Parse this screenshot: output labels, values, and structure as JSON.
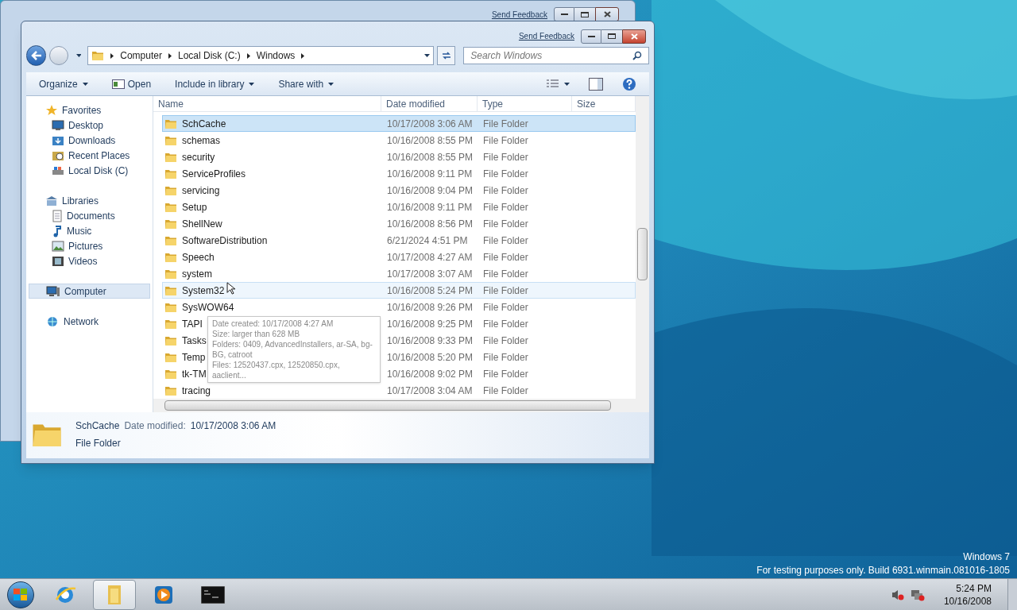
{
  "back_window": {
    "feedback_link": "Send Feedback"
  },
  "window": {
    "feedback_link": "Send Feedback"
  },
  "address_bar": {
    "crumbs": [
      "Computer",
      "Local Disk (C:)",
      "Windows"
    ]
  },
  "search": {
    "placeholder": "Search Windows"
  },
  "toolbar": {
    "items": [
      {
        "label": "Organize",
        "kind": "menu"
      },
      {
        "label": "Open",
        "kind": "icon"
      },
      {
        "label": "Include in library",
        "kind": "menu"
      },
      {
        "label": "Share with",
        "kind": "menu"
      }
    ]
  },
  "nav": {
    "groups": [
      {
        "label": "Favorites",
        "selected": false,
        "children": [
          {
            "label": "Desktop",
            "selected": false
          },
          {
            "label": "Downloads",
            "selected": false
          },
          {
            "label": "Recent Places",
            "selected": false
          },
          {
            "label": "Local Disk (C)",
            "selected": false
          }
        ]
      },
      {
        "label": "Libraries",
        "selected": false,
        "children": [
          {
            "label": "Documents",
            "selected": false
          },
          {
            "label": "Music",
            "selected": false
          },
          {
            "label": "Pictures",
            "selected": false
          },
          {
            "label": "Videos",
            "selected": false
          }
        ]
      },
      {
        "label": "Computer",
        "selected": true
      },
      {
        "label": "Network",
        "selected": false
      }
    ]
  },
  "table": {
    "columns": [
      "Name",
      "Date modified",
      "Type",
      "Size"
    ],
    "rows": [
      {
        "name": "SchCache",
        "date": "10/17/2008 3:06 AM",
        "type": "File Folder",
        "selected": true,
        "hovered": false
      },
      {
        "name": "schemas",
        "date": "10/16/2008 8:55 PM",
        "type": "File Folder",
        "selected": false,
        "hovered": false
      },
      {
        "name": "security",
        "date": "10/16/2008 8:55 PM",
        "type": "File Folder",
        "selected": false,
        "hovered": false
      },
      {
        "name": "ServiceProfiles",
        "date": "10/16/2008 9:11 PM",
        "type": "File Folder",
        "selected": false,
        "hovered": false
      },
      {
        "name": "servicing",
        "date": "10/16/2008 9:04 PM",
        "type": "File Folder",
        "selected": false,
        "hovered": false
      },
      {
        "name": "Setup",
        "date": "10/16/2008 9:11 PM",
        "type": "File Folder",
        "selected": false,
        "hovered": false
      },
      {
        "name": "ShellNew",
        "date": "10/16/2008 8:56 PM",
        "type": "File Folder",
        "selected": false,
        "hovered": false
      },
      {
        "name": "SoftwareDistribution",
        "date": "6/21/2024 4:51 PM",
        "type": "File Folder",
        "selected": false,
        "hovered": false
      },
      {
        "name": "Speech",
        "date": "10/17/2008 4:27 AM",
        "type": "File Folder",
        "selected": false,
        "hovered": false
      },
      {
        "name": "system",
        "date": "10/17/2008 3:07 AM",
        "type": "File Folder",
        "selected": false,
        "hovered": false
      },
      {
        "name": "System32",
        "date": "10/16/2008 5:24 PM",
        "type": "File Folder",
        "selected": false,
        "hovered": true
      },
      {
        "name": "SysWOW64",
        "date": "10/16/2008 9:26 PM",
        "type": "File Folder",
        "selected": false,
        "hovered": false
      },
      {
        "name": "TAPI",
        "date": "10/16/2008 9:25 PM",
        "type": "File Folder",
        "selected": false,
        "hovered": false
      },
      {
        "name": "Tasks",
        "date": "10/16/2008 9:33 PM",
        "type": "File Folder",
        "selected": false,
        "hovered": false
      },
      {
        "name": "Temp",
        "date": "10/16/2008 5:20 PM",
        "type": "File Folder",
        "selected": false,
        "hovered": false
      },
      {
        "name": "tk-TM",
        "date": "10/16/2008 9:02 PM",
        "type": "File Folder",
        "selected": false,
        "hovered": false
      },
      {
        "name": "tracing",
        "date": "10/17/2008 3:04 AM",
        "type": "File Folder",
        "selected": false,
        "hovered": false
      }
    ]
  },
  "tooltip": {
    "lines": [
      "Date created: 10/17/2008 4:27 AM",
      "Size: larger than 628 MB",
      "Folders: 0409, AdvancedInstallers, ar-SA, bg-BG, catroot",
      "Files: 12520437.cpx, 12520850.cpx, aaclient..."
    ]
  },
  "details_pane": {
    "name": "SchCache",
    "date_label": "Date modified:",
    "date": "10/17/2008 3:06 AM",
    "type": "File Folder"
  },
  "watermark": {
    "edition": "Windows 7",
    "build": "For testing purposes only. Build 6931.winmain.081016-1805"
  },
  "taskbar": {
    "apps": [
      {
        "kind": "ie",
        "selected": false
      },
      {
        "kind": "explorer",
        "selected": true
      },
      {
        "kind": "media",
        "selected": false
      },
      {
        "kind": "cmd",
        "selected": false
      }
    ],
    "time": "5:24 PM",
    "date": "10/16/2008"
  }
}
